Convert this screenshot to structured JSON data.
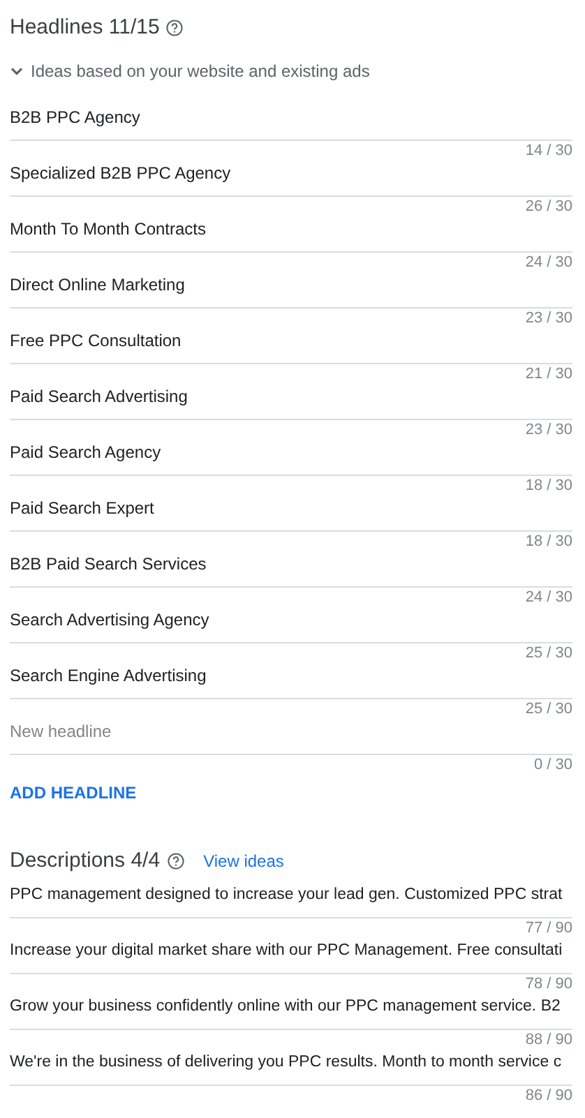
{
  "headlines": {
    "title": "Headlines 11/15",
    "ideas": {
      "label": "Ideas based on your website and existing ads",
      "expanded": true
    },
    "fields": [
      {
        "value": "B2B PPC Agency",
        "counter": "14 / 30"
      },
      {
        "value": "Specialized B2B PPC Agency",
        "counter": "26 / 30"
      },
      {
        "value": "Month To Month Contracts",
        "counter": "24 / 30"
      },
      {
        "value": "Direct Online Marketing",
        "counter": "23 / 30"
      },
      {
        "value": "Free PPC Consultation",
        "counter": "21 / 30"
      },
      {
        "value": "Paid Search Advertising",
        "counter": "23 / 30"
      },
      {
        "value": "Paid Search Agency",
        "counter": "18 / 30"
      },
      {
        "value": "Paid Search Expert",
        "counter": "18 / 30"
      },
      {
        "value": "B2B Paid Search Services",
        "counter": "24 / 30"
      },
      {
        "value": "Search Advertising Agency",
        "counter": "25 / 30"
      },
      {
        "value": "Search Engine Advertising",
        "counter": "25 / 30"
      },
      {
        "placeholder": "New headline",
        "counter": "0 / 30"
      }
    ],
    "add_button": "ADD HEADLINE"
  },
  "descriptions": {
    "title": "Descriptions 4/4",
    "view_ideas": "View ideas",
    "fields": [
      {
        "value": "PPC management designed to increase your lead gen. Customized PPC strat",
        "counter": "77 / 90"
      },
      {
        "value": "Increase your digital market share with our PPC Management. Free consultati",
        "counter": "78 / 90"
      },
      {
        "value": "Grow your business confidently online with our PPC management service. B2",
        "counter": "88 / 90"
      },
      {
        "value": "We're in the business of delivering you PPC results. Month to month service c",
        "counter": "86 / 90"
      }
    ]
  }
}
